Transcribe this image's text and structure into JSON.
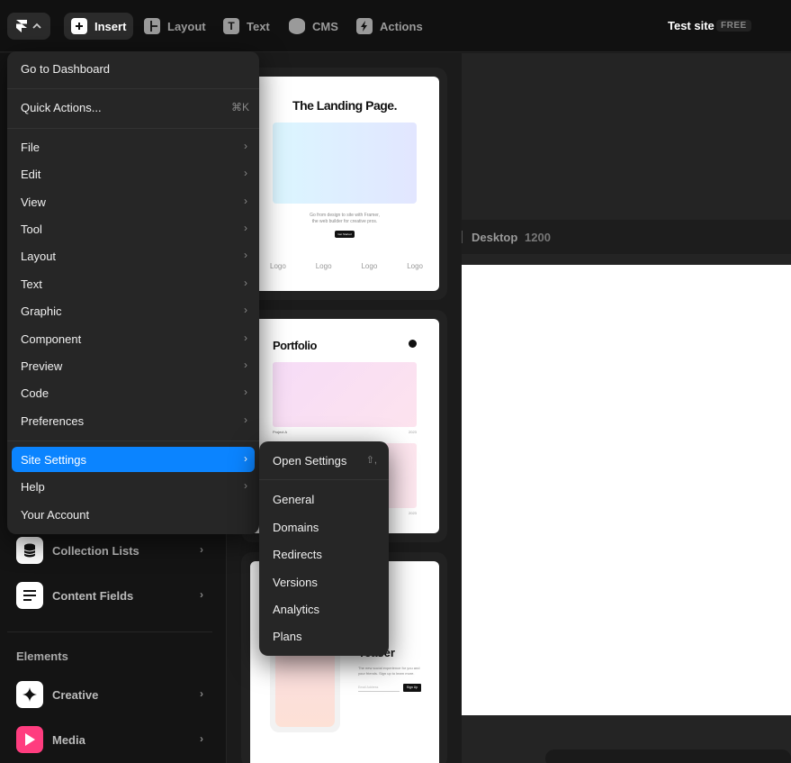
{
  "topbar": {
    "items": [
      {
        "label": "Insert",
        "icon": "plus-square-icon",
        "active": true
      },
      {
        "label": "Layout",
        "icon": "layout-icon"
      },
      {
        "label": "Text",
        "icon": "text-t-icon"
      },
      {
        "label": "CMS",
        "icon": "database-icon"
      },
      {
        "label": "Actions",
        "icon": "lightning-icon"
      }
    ],
    "site_title": "Test site",
    "plan_badge": "FREE"
  },
  "left_panel": {
    "cms_items": [
      {
        "label": "Collection Lists",
        "icon": "database-icon"
      },
      {
        "label": "Content Fields",
        "icon": "lines-icon"
      }
    ],
    "elements_heading": "Elements",
    "element_items": [
      {
        "label": "Creative",
        "icon": "sparkle-icon",
        "color": "#ffffff"
      },
      {
        "label": "Media",
        "icon": "play-icon",
        "color": "#ff3d7f"
      }
    ]
  },
  "templates": {
    "landing_title": "The Landing Page.",
    "landing_desc_1": "Go from design to site with Framer,",
    "landing_desc_2": "the web builder for creative pros.",
    "landing_cta": "Get Started",
    "landing_logos": [
      "Logo",
      "Logo",
      "Logo",
      "Logo"
    ],
    "portfolio_title": "Portfolio",
    "portfolio_project": "Project A",
    "portfolio_year": "2023",
    "portfolio_year_2": "2023",
    "teaser_title": "Teaser",
    "teaser_desc_1": "The new social experience for you and",
    "teaser_desc_2": "your friends. Sign up to learn more.",
    "teaser_input_placeholder": "Email Address",
    "teaser_button": "Sign Up"
  },
  "canvas": {
    "breakpoint_name": "Desktop",
    "breakpoint_width": "1200"
  },
  "main_menu": {
    "dashboard": "Go to Dashboard",
    "quick_actions": "Quick Actions...",
    "quick_actions_shortcut": "⌘K",
    "submenus": [
      "File",
      "Edit",
      "View",
      "Tool",
      "Layout",
      "Text",
      "Graphic",
      "Component",
      "Preview",
      "Code",
      "Preferences"
    ],
    "site_settings": "Site Settings",
    "help": "Help",
    "account": "Your Account"
  },
  "site_settings_menu": {
    "open_settings": "Open Settings",
    "open_settings_shortcut": "⇧,",
    "items": [
      "General",
      "Domains",
      "Redirects",
      "Versions",
      "Analytics",
      "Plans"
    ]
  },
  "colors": {
    "accent": "#0b84ff",
    "menu_bg": "#262626",
    "app_bg": "#111111"
  }
}
